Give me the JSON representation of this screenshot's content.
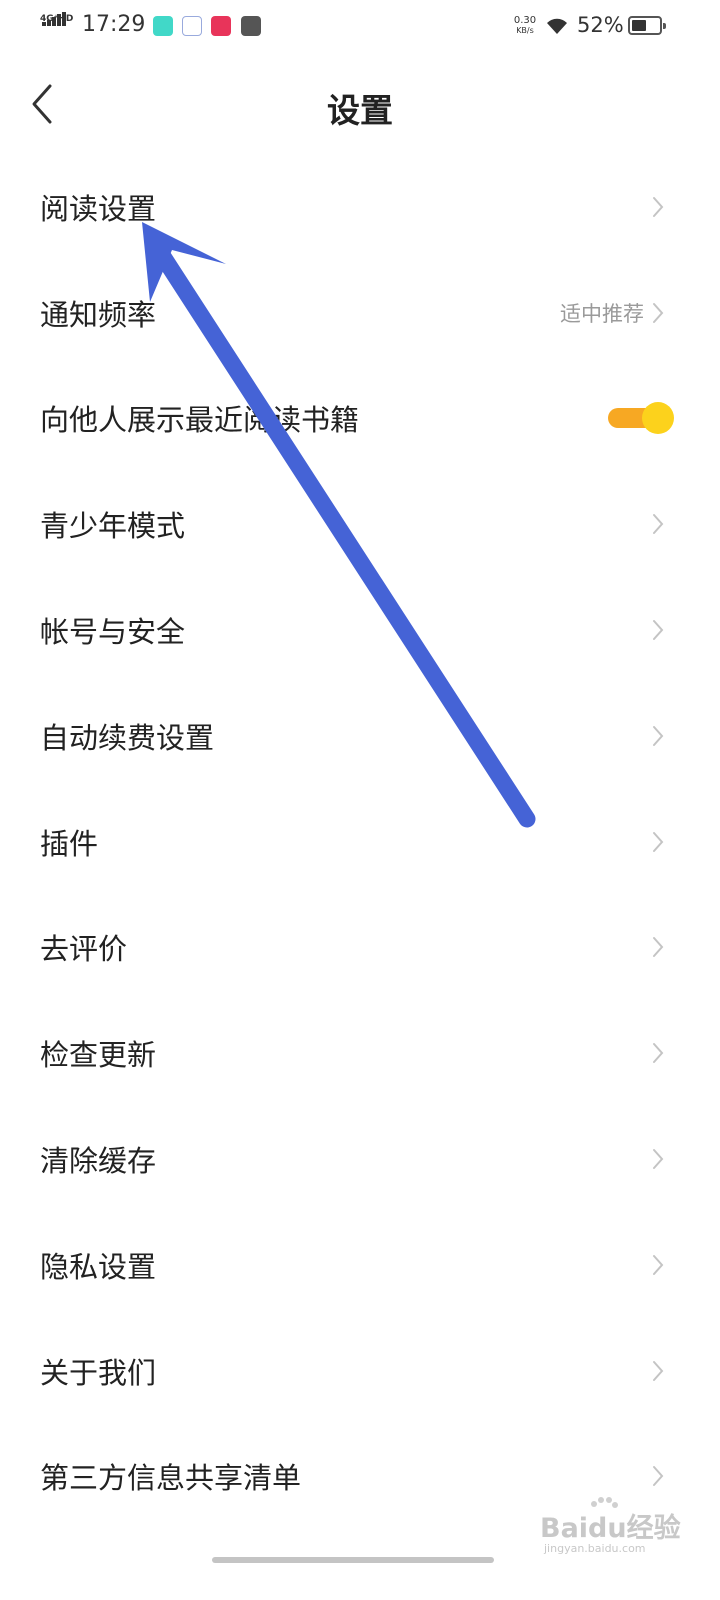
{
  "status_bar": {
    "network": "4G⁺HD",
    "time": "17:29",
    "net_speed_value": "0.30",
    "net_speed_unit": "KB/s",
    "battery_percent": "52%",
    "battery_level": 0.52
  },
  "header": {
    "title": "设置"
  },
  "settings": [
    {
      "label": "阅读设置",
      "type": "link"
    },
    {
      "label": "通知频率",
      "type": "link",
      "value": "适中推荐"
    },
    {
      "label": "向他人展示最近阅读书籍",
      "type": "toggle",
      "on": true
    },
    {
      "label": "青少年模式",
      "type": "link"
    },
    {
      "label": "帐号与安全",
      "type": "link"
    },
    {
      "label": "自动续费设置",
      "type": "link"
    },
    {
      "label": "插件",
      "type": "link"
    },
    {
      "label": "去评价",
      "type": "link"
    },
    {
      "label": "检查更新",
      "type": "link"
    },
    {
      "label": "清除缓存",
      "type": "link"
    },
    {
      "label": "隐私设置",
      "type": "link"
    },
    {
      "label": "关于我们",
      "type": "link"
    },
    {
      "label": "第三方信息共享清单",
      "type": "link"
    }
  ],
  "watermark": {
    "text": "Baidu经验",
    "sub": "jingyan.baidu.com"
  },
  "colors": {
    "toggle_track": "#f7a823",
    "toggle_knob": "#fcd21c",
    "annotation_arrow": "#4563d6",
    "chevron": "#c4c4c4",
    "value_text": "#9a9a9a"
  },
  "icons": {
    "back": "chevron-left-icon",
    "row_arrow": "chevron-right-icon",
    "wifi": "wifi-icon",
    "battery": "battery-icon",
    "signal": "signal-icon"
  }
}
